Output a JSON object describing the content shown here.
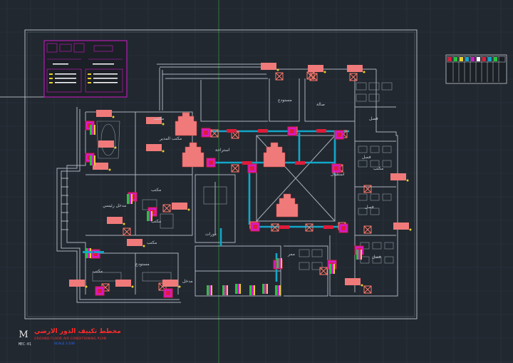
{
  "rooms": {
    "r1": "مكتب",
    "r2": "مكتب المدير",
    "r3": "مكتب",
    "r4": "مكتب",
    "r5": "صالة",
    "r6": "مستودع",
    "r7": "استراحة",
    "r8": "دورات",
    "r9": "مدخل",
    "r10": "ممر",
    "r11": "فصل",
    "r12": "فصل",
    "r13": "فصل",
    "r14": "فصل",
    "r15": "مكتب",
    "r16": "مكتب",
    "r17": "مدخل رئيسي",
    "r18": "مستودع",
    "r19": "مكتب",
    "r20": "استقبال"
  },
  "title_block": {
    "logo_letter": "M",
    "drawing_code": "MEC-01",
    "title_ar": "مخطط تكييف الدور الارضي",
    "title_en": "GROUND FLOOR AIR CONDITIONING PLAN",
    "subtitle": "SCALE 1:100"
  },
  "colors": {
    "background": "#212830",
    "grid": "#2e3640",
    "walls": "#aab3bd",
    "duct": "#13a6c9",
    "diffuser_label": "#f07a7a",
    "unit_red": "#e01b3a",
    "magenta": "#d21bc9",
    "green": "#28c43c",
    "yellow": "#e8d22a"
  }
}
